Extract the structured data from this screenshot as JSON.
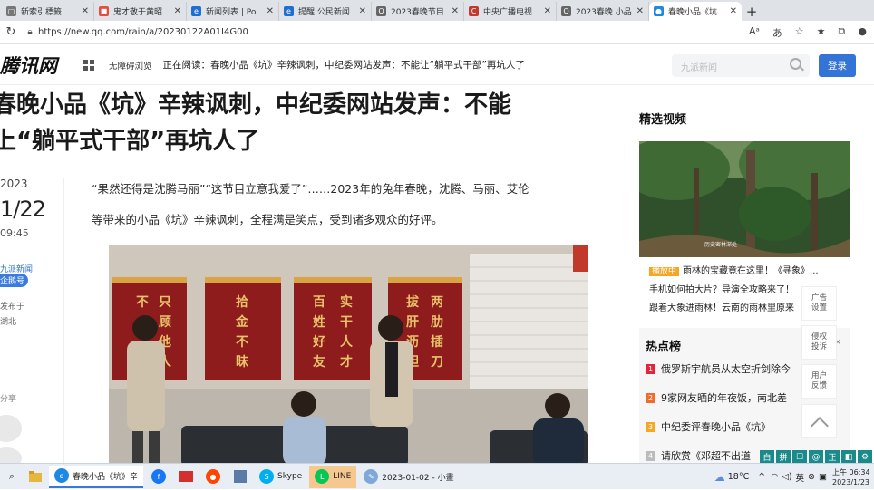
{
  "tabs": [
    {
      "label": "新索引標籤",
      "color": "#777",
      "glyph": "▢"
    },
    {
      "label": "鬼才敬于黄昭",
      "color": "#e84c3d",
      "glyph": "■"
    },
    {
      "label": "新闻列表 | Po",
      "color": "#1f6fd0",
      "glyph": "e"
    },
    {
      "label": "提醒 公民新闻",
      "color": "#1f6fd0",
      "glyph": "e"
    },
    {
      "label": "2023春晚节目",
      "color": "#666",
      "glyph": "Q"
    },
    {
      "label": "中央广播电视",
      "color": "#c0392b",
      "glyph": "C"
    },
    {
      "label": "2023春晚 小品",
      "color": "#666",
      "glyph": "Q"
    },
    {
      "label": "春晚小品《坑",
      "color": "#1e88e5",
      "glyph": "●"
    }
  ],
  "address": {
    "url": "https://new.qq.com/rain/a/20230122A01I4G00"
  },
  "site": {
    "logo": "腾讯网",
    "a11y": "无障碍浏览",
    "reading": "正在阅读：春晚小品《坑》辛辣讽刺，中纪委网站发声：不能让“躺平式干部”再坑人了",
    "search_placeholder": "九派新闻",
    "login": "登录"
  },
  "article": {
    "headline_line1": "春晚小品《坑》辛辣讽刺，中纪委网站发声：不能",
    "headline_line2": "上“躺平式干部”再坑人了",
    "date_year": "2023",
    "date_day": "1/22",
    "time": "09:45",
    "source": "九派新闻",
    "badge": "企鹅号",
    "pub_line1": "发布于",
    "pub_line2": "湖北",
    "share": "分享",
    "para_line1": "“果然还得是沈腾马丽”“这节目立意我爱了”……2023年的兔年春晚，沈腾、马丽、艾伦",
    "para_line2": "等带来的小品《坑》辛辣讽刺，全程满是笑点，受到诸多观众的好评。",
    "banners": [
      [
        "只",
        "顾",
        "他",
        "人"
      ],
      [
        "拾",
        "金",
        "不",
        "昧"
      ],
      [
        "实",
        "干",
        "人",
        "才"
      ],
      [
        "两",
        "肋",
        "插",
        "刀"
      ]
    ],
    "banner_left_col": [
      "不"
    ],
    "banner3_left": [
      "百",
      "姓",
      "好",
      "友"
    ],
    "banner4_left": [
      "拔",
      "肝",
      "沥",
      "胆"
    ]
  },
  "sidebar": {
    "video_title": "精选视频",
    "video_caption": "历史密林深处",
    "vid_tag": "播放中",
    "vid_line1": "雨林的宝藏竟在这里！《寻象》...",
    "vid_line2": "手机如何拍大片？导演全攻略来了！",
    "vid_line3": "跟着大象进雨林！云南的雨林里原来",
    "hot_title": "热点榜",
    "hot_items": [
      {
        "num": "1",
        "text": "俄罗斯宇航员从太空折剑除今",
        "color": "#e5243b"
      },
      {
        "num": "2",
        "text": "9家网友晒的年夜饭，南北差",
        "color": "#f26b2b"
      },
      {
        "num": "3",
        "text": "中纪委评春晚小品《坑》",
        "color": "#f5a623"
      },
      {
        "num": "4",
        "text": "请欣赏《邓超不出道",
        "color": "#bbb"
      }
    ],
    "float_ad": [
      "广告",
      "设置"
    ],
    "float_report": [
      "侵权",
      "投诉"
    ],
    "float_feedback": [
      "用户",
      "反馈"
    ]
  },
  "ime": [
    "白",
    "拼",
    "☐",
    "@",
    "正",
    "◧",
    "⚙"
  ],
  "taskbar": {
    "apps": [
      {
        "label": "春晚小品《坑》辛",
        "state": "on",
        "color": "#1e88e5",
        "glyph": "e"
      },
      {
        "label": "Skype",
        "state": "",
        "color": "#00aff0",
        "glyph": "S"
      },
      {
        "label": "LINE",
        "state": "hl",
        "color": "#06c755",
        "glyph": "L"
      },
      {
        "label": "2023-01-02 - 小畫",
        "state": "",
        "color": "#7fa7d8",
        "glyph": "✎"
      }
    ],
    "weather": "18°C",
    "lang": "英",
    "time": "上午 06:34",
    "date": "2023/1/23"
  }
}
